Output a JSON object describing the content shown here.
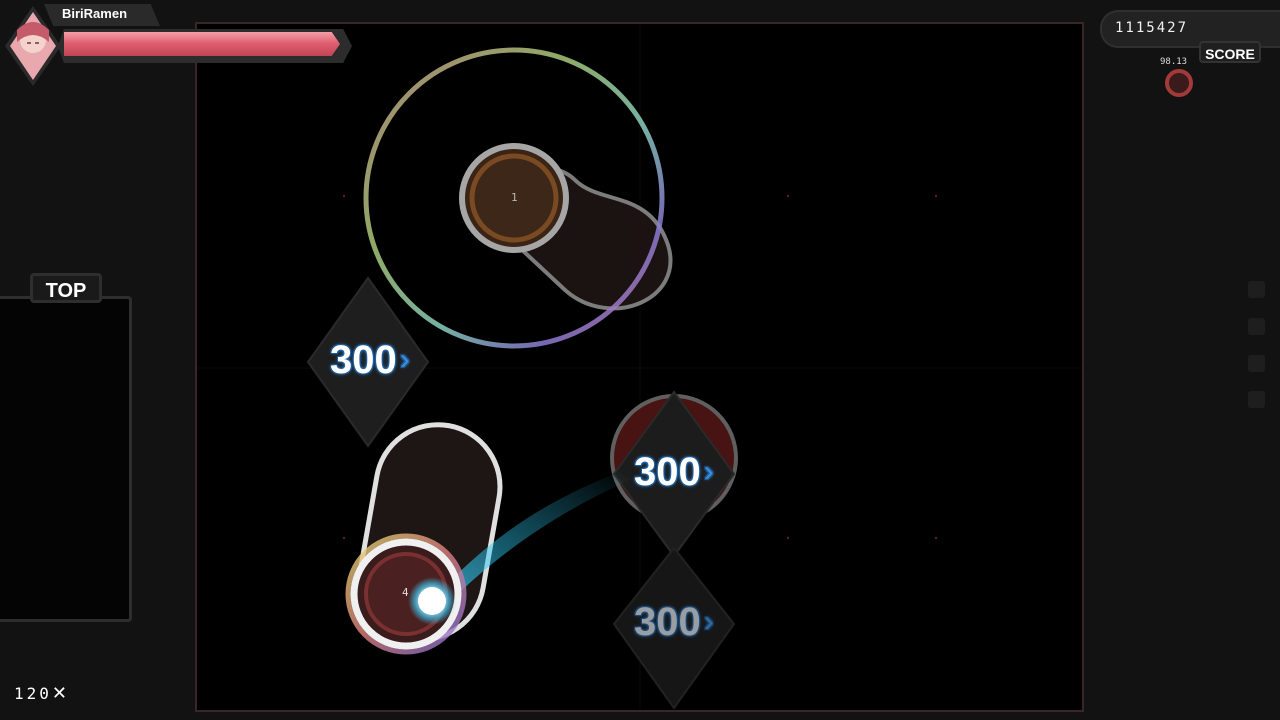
{
  "player": {
    "name": "BiriRamen",
    "health_fraction": 0.98
  },
  "hud": {
    "score": "1115427",
    "score_label": "SCORE",
    "accuracy": "98.13",
    "leaderboard_label": "TOP",
    "combo": "120",
    "combo_suffix": "✕",
    "key_counters": 4
  },
  "judgements": [
    {
      "value": "300",
      "chevron": "›"
    },
    {
      "value": "300",
      "chevron": "›"
    },
    {
      "value": "300",
      "chevron": "›"
    }
  ],
  "hit_objects": [
    {
      "type": "slider",
      "combo_number": "1"
    },
    {
      "type": "slider",
      "combo_number": "4"
    },
    {
      "type": "hit-circle"
    }
  ],
  "colors": {
    "health": "#e06070",
    "judgement_glow": "#2a7fd0",
    "cursor_trail": "#2ec8f0",
    "playfield_border": "#3a2626"
  }
}
